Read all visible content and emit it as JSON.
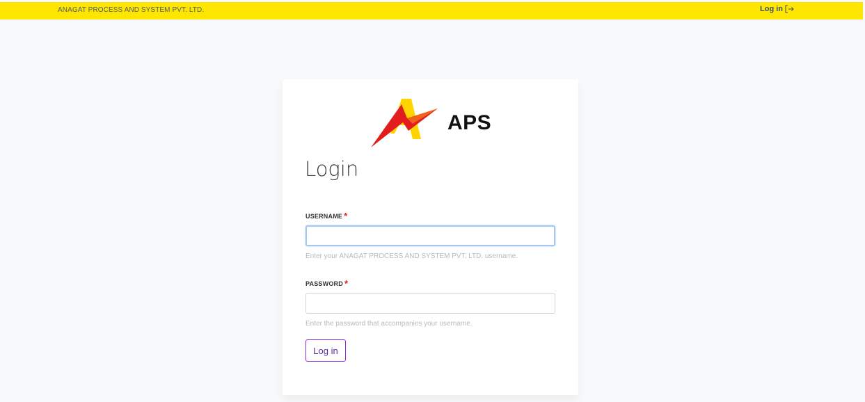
{
  "header": {
    "brand": "ANAGAT PROCESS AND SYSTEM PVT. LTD.",
    "login_link": "Log in",
    "background_color": "#ffe600"
  },
  "logo": {
    "text": "APS",
    "colors": [
      "#e11d1d",
      "#ffd400",
      "#111111"
    ]
  },
  "form": {
    "title": "Login",
    "username": {
      "label": "USERNAME",
      "required_mark": "*",
      "value": "",
      "hint": "Enter your ANAGAT PROCESS AND SYSTEM PVT. LTD. username."
    },
    "password": {
      "label": "PASSWORD",
      "required_mark": "*",
      "value": "",
      "hint": "Enter the password that accompanies your username."
    },
    "submit_label": "Log in",
    "accent_color": "#8a2be2"
  }
}
